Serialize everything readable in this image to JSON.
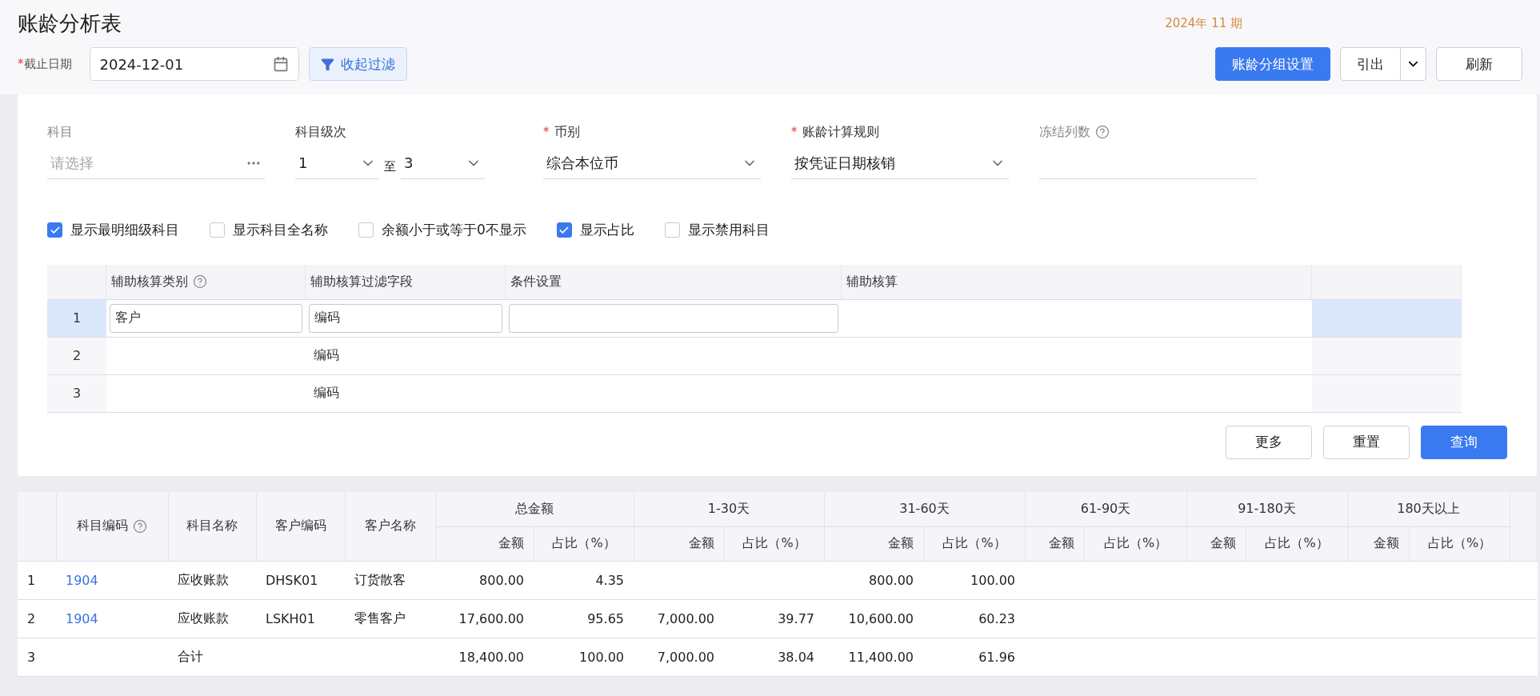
{
  "header": {
    "title": "账龄分析表",
    "period": "2024年 11 期"
  },
  "toolbar": {
    "date_required_mark": "*",
    "date_label": "截止日期",
    "date_value": "2024-12-01",
    "collapse_button": "收起过滤",
    "group_button": "账龄分组设置",
    "export_button": "引出",
    "refresh_button": "刷新"
  },
  "fields": [
    {
      "kind": "picker",
      "label": "科目",
      "placeholder": "请选择"
    },
    {
      "kind": "range",
      "label": "科目级次",
      "from": "1",
      "separator": "至",
      "to": "3"
    },
    {
      "kind": "select",
      "required_mark": "*",
      "label": "币别",
      "value": "综合本位币"
    },
    {
      "kind": "select",
      "required_mark": "*",
      "label": "账龄计算规则",
      "value": "按凭证日期核销"
    },
    {
      "kind": "text",
      "label": "冻结列数",
      "help": true
    }
  ],
  "checkboxes": [
    {
      "label": "显示最明细级科目",
      "checked": true
    },
    {
      "label": "显示科目全名称",
      "checked": false
    },
    {
      "label": "余额小于或等于0不显示",
      "checked": false
    },
    {
      "label": "显示占比",
      "checked": true
    },
    {
      "label": "显示禁用科目",
      "checked": false
    }
  ],
  "aux_table": {
    "columns": [
      {
        "label": "辅助核算类别",
        "help": true
      },
      {
        "label": "辅助核算过滤字段"
      },
      {
        "label": "条件设置"
      },
      {
        "label": "辅助核算"
      }
    ],
    "rows": [
      {
        "index": "1",
        "category": "客户",
        "filter_field": "编码",
        "editing": true
      },
      {
        "index": "2",
        "filter_field": "编码",
        "editing": false
      },
      {
        "index": "3",
        "filter_field": "编码",
        "editing": false
      }
    ]
  },
  "actions": [
    {
      "label": "更多",
      "primary": false
    },
    {
      "label": "重置",
      "primary": false
    },
    {
      "label": "查询",
      "primary": true
    }
  ],
  "result_table": {
    "fixed_columns": [
      {
        "label": "科目编码",
        "help": true
      },
      {
        "label": "科目名称"
      },
      {
        "label": "客户编码"
      },
      {
        "label": "客户名称"
      }
    ],
    "groups": [
      {
        "label": "总金额",
        "sub": [
          "金额",
          "占比（%）"
        ]
      },
      {
        "label": "1-30天",
        "sub": [
          "金额",
          "占比（%）"
        ]
      },
      {
        "label": "31-60天",
        "sub": [
          "金额",
          "占比（%）"
        ]
      },
      {
        "label": "61-90天",
        "sub": [
          "金额",
          "占比（%）"
        ]
      },
      {
        "label": "91-180天",
        "sub": [
          "金额",
          "占比（%）"
        ]
      },
      {
        "label": "180天以上",
        "sub": [
          "金额",
          "占比（%）"
        ]
      }
    ],
    "rows": [
      {
        "index": "1",
        "code": "1904",
        "name": "应收账款",
        "customer_code": "DHSK01",
        "customer_name": "订货散客",
        "amounts": [
          {
            "kind": "value",
            "amount": "800.00",
            "share": "4.35"
          },
          {
            "kind": "blank"
          },
          {
            "kind": "value",
            "amount": "800.00",
            "share": "100.00"
          }
        ]
      },
      {
        "index": "2",
        "code": "1904",
        "name": "应收账款",
        "customer_code": "LSKH01",
        "customer_name": "零售客户",
        "amounts": [
          {
            "kind": "value",
            "amount": "17,600.00",
            "share": "95.65"
          },
          {
            "kind": "value",
            "amount": "7,000.00",
            "share": "39.77"
          },
          {
            "kind": "value",
            "amount": "10,600.00",
            "share": "60.23"
          }
        ]
      },
      {
        "index": "3",
        "name": "合计",
        "amounts": [
          {
            "kind": "value",
            "amount": "18,400.00",
            "share": "100.00"
          },
          {
            "kind": "value",
            "amount": "7,000.00",
            "share": "38.04"
          },
          {
            "kind": "value",
            "amount": "11,400.00",
            "share": "61.96"
          }
        ]
      }
    ]
  }
}
